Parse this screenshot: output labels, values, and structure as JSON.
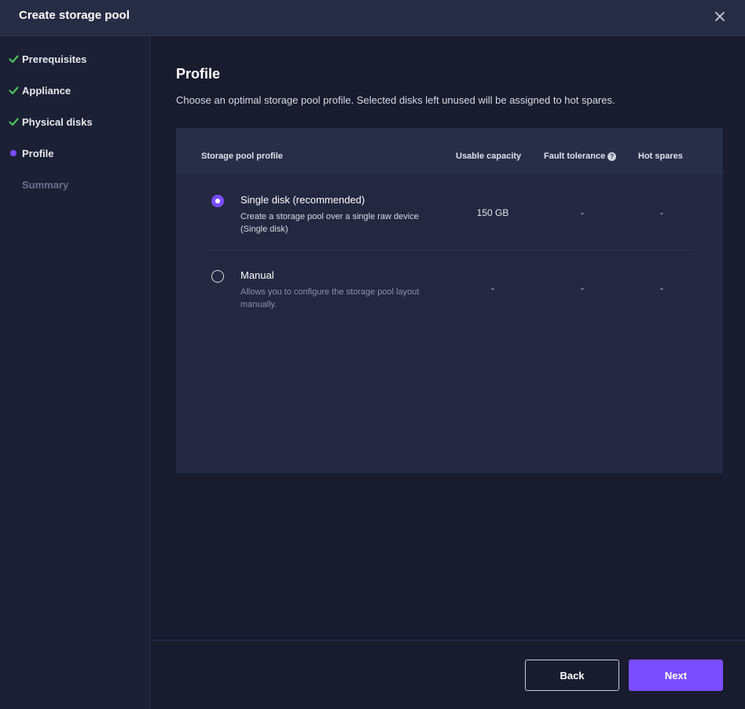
{
  "header": {
    "title": "Create storage pool",
    "close_icon": "close-icon"
  },
  "sidebar": {
    "steps": [
      {
        "label": "Prerequisites",
        "state": "done",
        "icon": "check-icon"
      },
      {
        "label": "Appliance",
        "state": "done",
        "icon": "check-icon"
      },
      {
        "label": "Physical disks",
        "state": "done",
        "icon": "check-icon"
      },
      {
        "label": "Profile",
        "state": "current",
        "icon": "current-dot-icon"
      },
      {
        "label": "Summary",
        "state": "pending",
        "icon": ""
      }
    ]
  },
  "main": {
    "title": "Profile",
    "description": "Choose an optimal storage pool profile. Selected disks left unused will be assigned to hot spares."
  },
  "table": {
    "columns": {
      "profile": "Storage pool profile",
      "capacity": "Usable capacity",
      "fault": "Fault tolerance",
      "hot": "Hot spares"
    },
    "rows": [
      {
        "title": "Single disk (recommended)",
        "description": "Create a storage pool over a single raw device (Single disk)",
        "capacity": "150 GB",
        "fault": "-",
        "hot": "-",
        "selected": true
      },
      {
        "title": "Manual",
        "description": "Allows you to configure the storage pool layout manually.",
        "capacity": "-",
        "fault": "-",
        "hot": "-",
        "selected": false
      }
    ]
  },
  "footer": {
    "back_label": "Back",
    "next_label": "Next"
  },
  "colors": {
    "accent": "#7a4dff",
    "success": "#4cc35a",
    "background": "#181c2e",
    "header": "#262c44"
  }
}
